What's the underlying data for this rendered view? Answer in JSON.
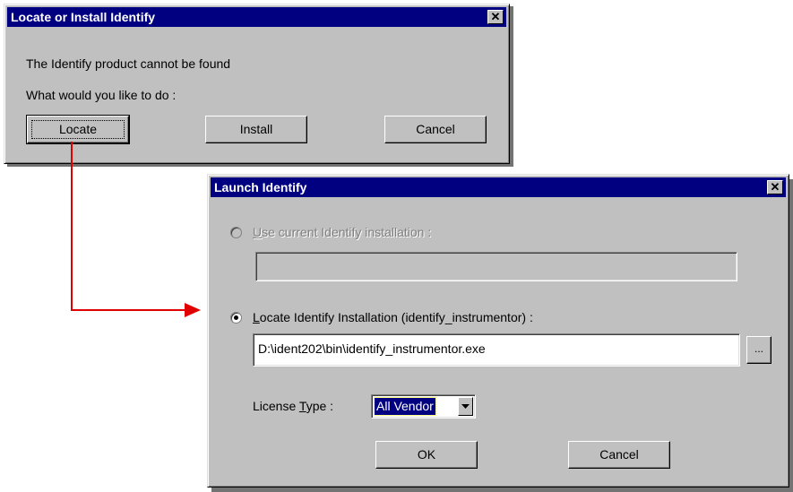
{
  "dialog1": {
    "title": "Locate or Install Identify",
    "close_glyph": "✕",
    "message": "The Identify product cannot be found",
    "question": "What would you like to do :",
    "buttons": {
      "locate": "Locate",
      "install": "Install",
      "cancel": "Cancel"
    }
  },
  "dialog2": {
    "title": "Launch Identify",
    "close_glyph": "✕",
    "radio_current": {
      "accel": "U",
      "rest": "se current Identify installation :"
    },
    "current_path": "",
    "radio_locate": {
      "accel": "L",
      "rest": "ocate Identify Installation (identify_instrumentor) :"
    },
    "locate_path": "D:\\ident202\\bin\\identify_instrumentor.exe",
    "browse_label": "...",
    "license": {
      "pre": "License ",
      "accel": "T",
      "post": "ype :",
      "value": "All Vendor"
    },
    "buttons": {
      "ok": "OK",
      "cancel": "Cancel"
    }
  },
  "colors": {
    "titlebar": "#000080",
    "face": "#c0c0c0",
    "arrow": "#e00000"
  }
}
